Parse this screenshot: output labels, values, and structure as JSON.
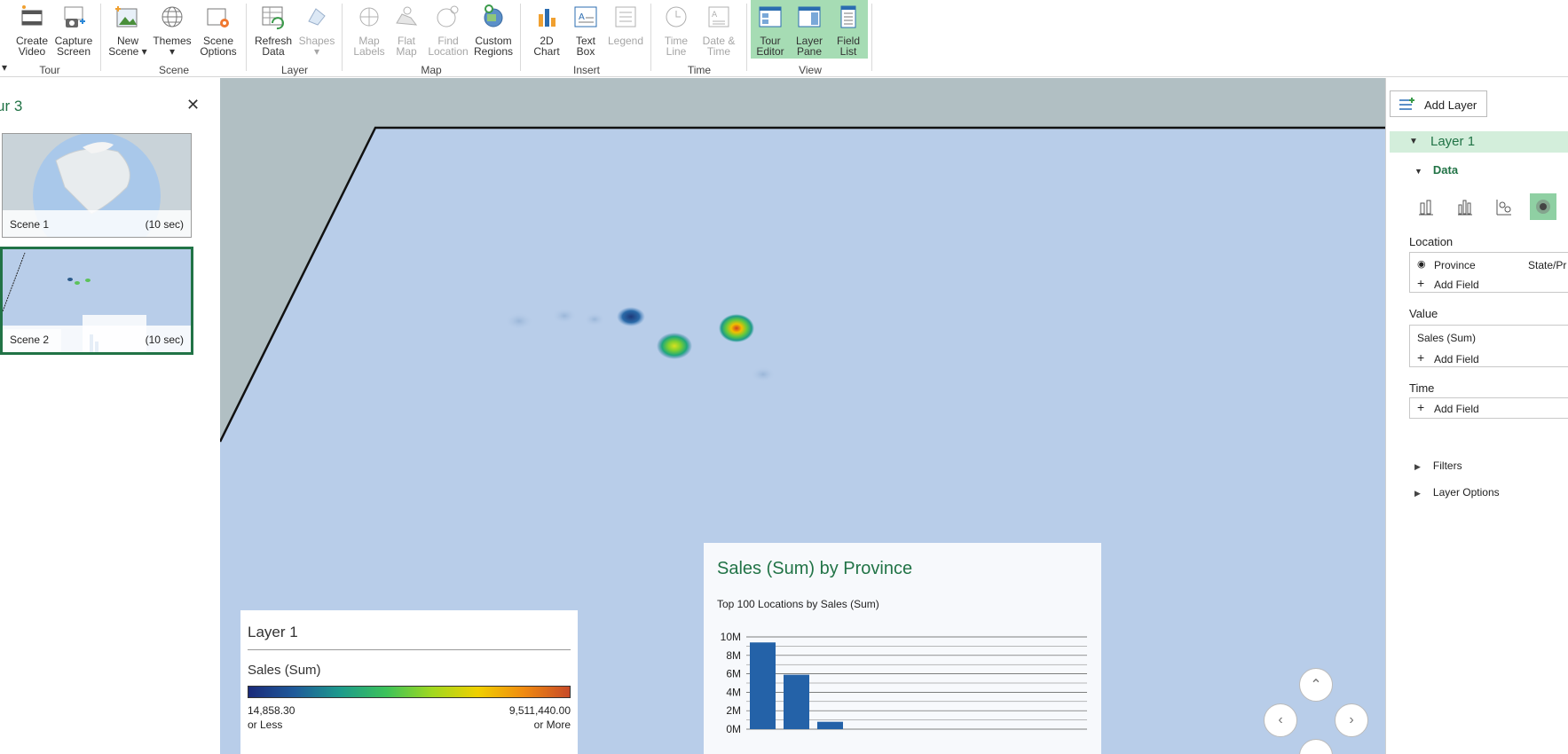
{
  "ribbon": {
    "groups": [
      {
        "name": "Tour",
        "buttons": [
          {
            "label1": "Create",
            "label2": "Video"
          },
          {
            "label1": "Capture",
            "label2": "Screen"
          }
        ]
      },
      {
        "name": "Scene",
        "buttons": [
          {
            "label1": "New",
            "label2": "Scene ▾"
          },
          {
            "label1": "Themes",
            "label2": "▾"
          },
          {
            "label1": "Scene",
            "label2": "Options"
          }
        ]
      },
      {
        "name": "Layer",
        "buttons": [
          {
            "label1": "Refresh",
            "label2": "Data"
          },
          {
            "label1": "Shapes",
            "label2": "▾"
          }
        ]
      },
      {
        "name": "Map",
        "buttons": [
          {
            "label1": "Map",
            "label2": "Labels"
          },
          {
            "label1": "Flat",
            "label2": "Map"
          },
          {
            "label1": "Find",
            "label2": "Location"
          },
          {
            "label1": "Custom",
            "label2": "Regions"
          }
        ]
      },
      {
        "name": "Insert",
        "buttons": [
          {
            "label1": "2D",
            "label2": "Chart"
          },
          {
            "label1": "Text",
            "label2": "Box"
          },
          {
            "label1": "Legend",
            "label2": ""
          }
        ]
      },
      {
        "name": "Time",
        "buttons": [
          {
            "label1": "Time",
            "label2": "Line"
          },
          {
            "label1": "Date &",
            "label2": "Time"
          }
        ]
      },
      {
        "name": "View",
        "buttons": [
          {
            "label1": "Tour",
            "label2": "Editor"
          },
          {
            "label1": "Layer",
            "label2": "Pane"
          },
          {
            "label1": "Field",
            "label2": "List"
          }
        ]
      }
    ]
  },
  "tour": {
    "title": "ur 3",
    "scenes": [
      {
        "name": "Scene 1",
        "duration": "(10 sec)"
      },
      {
        "name": "Scene 2",
        "duration": "(10 sec)"
      }
    ]
  },
  "legend": {
    "title": "Layer 1",
    "series": "Sales (Sum)",
    "min_value": "14,858.30",
    "min_label": "or Less",
    "max_value": "9,511,440.00",
    "max_label": "or More"
  },
  "chart": {
    "title": "Sales (Sum) by Province",
    "subtitle": "Top 100 Locations  by Sales (Sum)"
  },
  "chart_data": {
    "type": "bar",
    "title": "Sales (Sum) by Province",
    "subtitle": "Top 100 Locations  by Sales (Sum)",
    "yticks": [
      "10M",
      "8M",
      "6M",
      "4M",
      "2M",
      "0M"
    ],
    "ylim": [
      0,
      10
    ],
    "values": [
      9.4,
      5.9,
      0.8
    ],
    "color": "#2462a8",
    "grid": true
  },
  "layer_pane": {
    "add_layer": "Add Layer",
    "layer_name": "Layer 1",
    "data_header": "Data",
    "location_label": "Location",
    "location_field": "Province",
    "location_type": "State/Pr",
    "add_field": "Add Field",
    "value_label": "Value",
    "value_field": "Sales (Sum)",
    "time_label": "Time",
    "filters": "Filters",
    "layer_options": "Layer Options"
  },
  "colors": {
    "accent": "#217346",
    "active_button": "#a6dcb4",
    "map_plane": "#b8cde9",
    "viewport_bg": "#b1bfc3",
    "bar": "#2462a8"
  }
}
